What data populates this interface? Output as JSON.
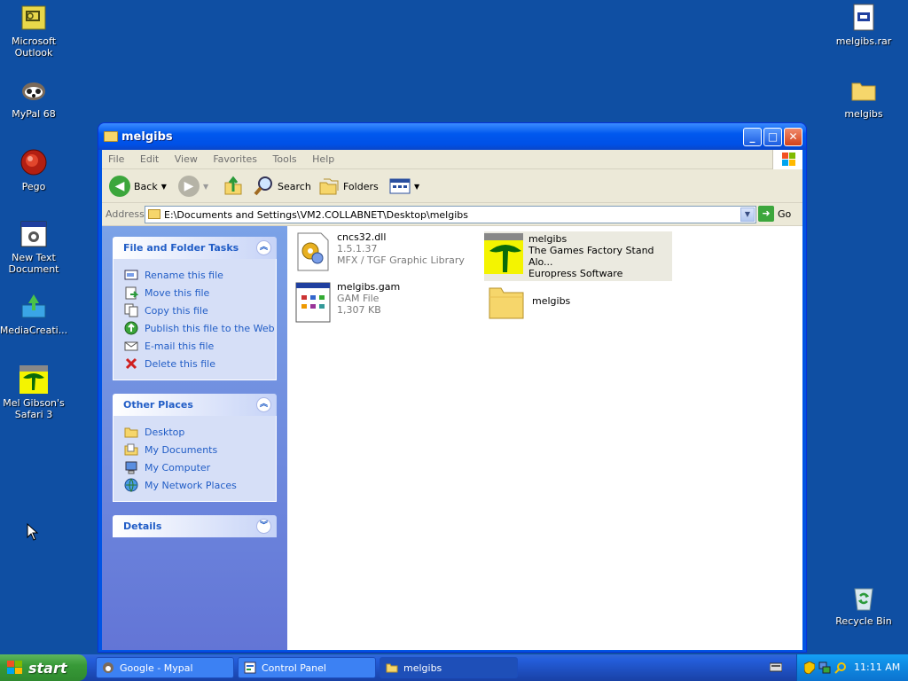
{
  "desktop": {
    "icons": [
      {
        "label": "Microsoft Outlook",
        "icon": "outlook-icon"
      },
      {
        "label": "MyPal 68",
        "icon": "mypal-icon"
      },
      {
        "label": "Pego",
        "icon": "pego-icon"
      },
      {
        "label": "New Text Document",
        "icon": "text-document-icon"
      },
      {
        "label": "MediaCreati...",
        "icon": "media-creation-icon"
      },
      {
        "label": "Mel Gibson's Safari 3",
        "icon": "game-shortcut-icon"
      },
      {
        "label": "melgibs.rar",
        "icon": "rar-archive-icon"
      },
      {
        "label": "melgibs",
        "icon": "folder-icon"
      },
      {
        "label": "Recycle Bin",
        "icon": "recycle-bin-icon"
      }
    ]
  },
  "window": {
    "title": "melgibs",
    "menu": [
      "File",
      "Edit",
      "View",
      "Favorites",
      "Tools",
      "Help"
    ],
    "toolbar": {
      "back": "Back",
      "search": "Search",
      "folders": "Folders"
    },
    "address": {
      "label": "Address",
      "value": "E:\\Documents and Settings\\VM2.COLLABNET\\Desktop\\melgibs",
      "go": "Go"
    },
    "tasks": {
      "title": "File and Folder Tasks",
      "items": [
        "Rename this file",
        "Move this file",
        "Copy this file",
        "Publish this file to the Web",
        "E-mail this file",
        "Delete this file"
      ]
    },
    "places": {
      "title": "Other Places",
      "items": [
        "Desktop",
        "My Documents",
        "My Computer",
        "My Network Places"
      ]
    },
    "details": {
      "title": "Details"
    },
    "files": [
      {
        "name": "cncs32.dll",
        "line2": "1.5.1.37",
        "line3": "MFX / TGF Graphic Library"
      },
      {
        "name": "melgibs",
        "line2": "The Games Factory Stand Alo...",
        "line3": "Europress Software"
      },
      {
        "name": "melgibs.gam",
        "line2": "GAM File",
        "line3": "1,307 KB"
      },
      {
        "name": "melgibs"
      }
    ]
  },
  "taskbar": {
    "start": "start",
    "tasks": [
      "Google - Mypal",
      "Control Panel",
      "melgibs"
    ],
    "clock": "11:11 AM"
  }
}
